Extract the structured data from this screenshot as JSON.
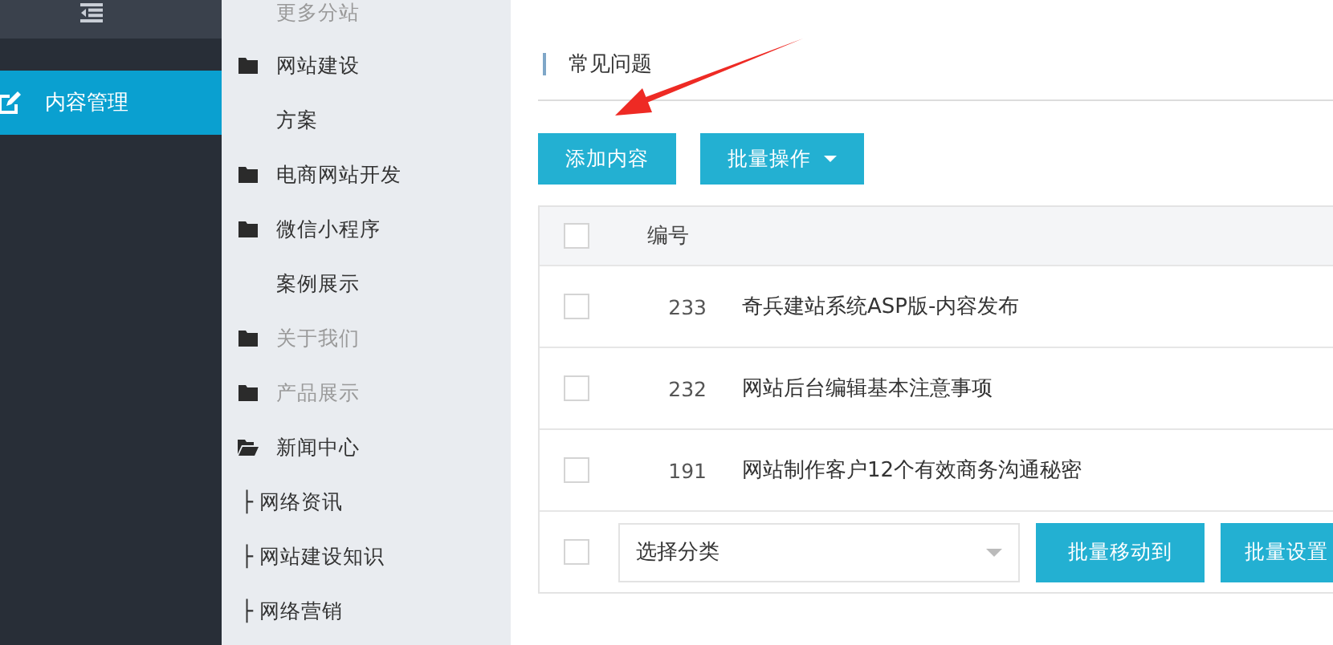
{
  "sidebar": {
    "items": [
      {
        "label": "内容管理",
        "selected": true
      }
    ]
  },
  "categories": [
    {
      "label": "更多分站",
      "kind": "plain",
      "disabled": true
    },
    {
      "label": "网站建设",
      "kind": "folder",
      "disabled": false
    },
    {
      "label": "方案",
      "kind": "plain",
      "disabled": false
    },
    {
      "label": "电商网站开发",
      "kind": "folder",
      "disabled": false
    },
    {
      "label": "微信小程序",
      "kind": "folder",
      "disabled": false
    },
    {
      "label": "案例展示",
      "kind": "plain",
      "disabled": false
    },
    {
      "label": "关于我们",
      "kind": "folder",
      "disabled": true
    },
    {
      "label": "产品展示",
      "kind": "folder",
      "disabled": true
    },
    {
      "label": "新闻中心",
      "kind": "open-folder",
      "disabled": false,
      "children": [
        {
          "label": "├ 网络资讯"
        },
        {
          "label": "├ 网站建设知识"
        },
        {
          "label": "├ 网络营销"
        }
      ]
    }
  ],
  "main": {
    "title": "常见问题",
    "buttons": [
      {
        "label": "添加内容",
        "dropdown": false
      },
      {
        "label": "批量操作",
        "dropdown": true
      }
    ],
    "table": {
      "header_checked": false,
      "columns": [
        "编号"
      ],
      "rows": [
        {
          "checked": false,
          "id": "233",
          "title": "奇兵建站系统ASP版-内容发布"
        },
        {
          "checked": false,
          "id": "232",
          "title": "网站后台编辑基本注意事项"
        },
        {
          "checked": false,
          "id": "191",
          "title": "网站制作客户12个有效商务沟通秘密"
        }
      ]
    },
    "footer": {
      "checked": false,
      "select_placeholder": "选择分类",
      "buttons": [
        "批量移动到",
        "批量设置"
      ]
    }
  }
}
